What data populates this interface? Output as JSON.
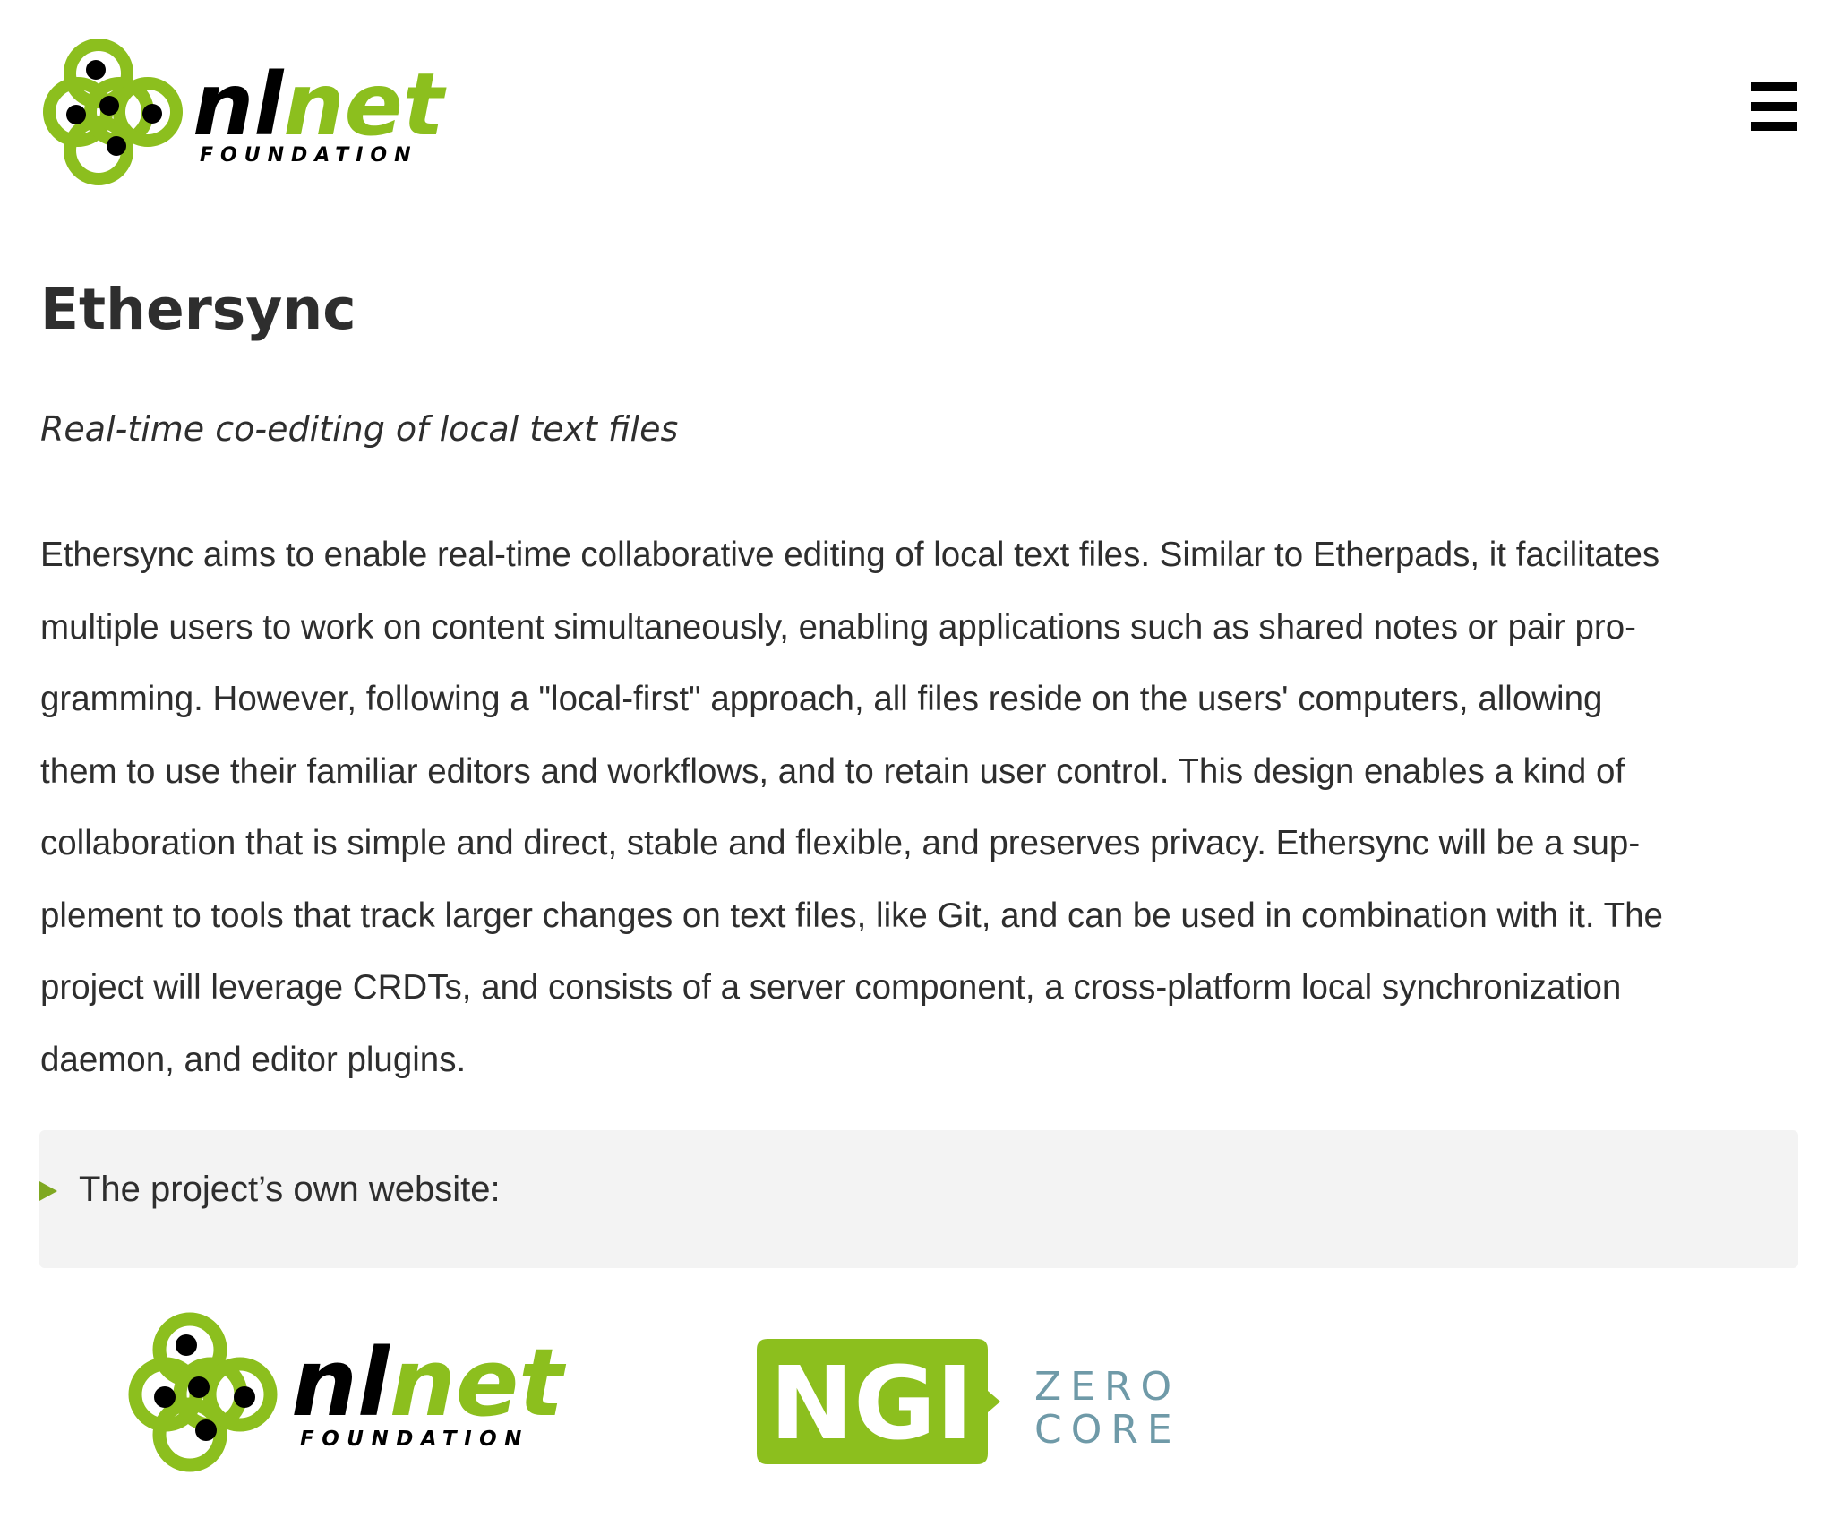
{
  "header": {
    "logo": {
      "wordmark": "nlnet",
      "tagline": "FOUNDATION",
      "icon": "nlnet-logo-icon"
    },
    "menu_icon": "hamburger-menu-icon"
  },
  "project": {
    "title": "Ethersync",
    "subtitle": "Real-time co-editing of local text files",
    "description_lines": [
      "Ethersync aims to enable real-time collaborative editing of local text files. Similar to Etherpads, it facilitates",
      "multiple users to work on content simultaneously, enabling applications such as shared notes or pair pro-",
      "gramming. However, following a \"local-first\" approach, all files reside on the users' computers, allowing",
      "them to use their familiar editors and workflows, and to retain user control. This design enables a kind of",
      "collaboration that is simple and direct, stable and flexible, and preserves privacy. Ethersync will be a sup-",
      "plement to tools that track larger changes on text files, like Git, and can be used in combination with it. The",
      "project will leverage CRDTs, and consists of a server component, a cross-platform local synchronization",
      "daemon, and editor plugins."
    ],
    "details_summary": "The project’s own website:"
  },
  "footer": {
    "nlnet_logo": {
      "wordmark": "nlnet",
      "tagline": "FOUNDATION"
    },
    "ngi_logo": {
      "badge": "NGI",
      "line1": "ZERO",
      "line2": "CORE"
    }
  },
  "colors": {
    "brand_green": "#8cbf1e",
    "ngi_gray_blue": "#6f9aa8",
    "text": "#2e2e2e",
    "details_bg": "#f3f3f3"
  }
}
